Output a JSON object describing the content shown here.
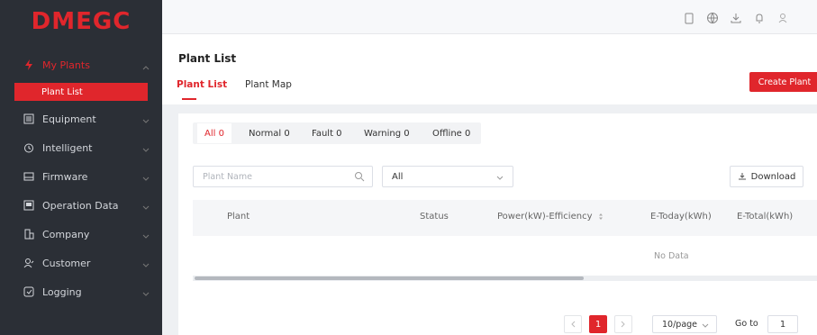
{
  "brand": {
    "logo_text": "DMEGC",
    "accent": "#e0262c"
  },
  "sidebar": {
    "items": [
      {
        "label": "My Plants",
        "icon": "lightning-icon",
        "active": true
      },
      {
        "label": "Plant List",
        "sub": true
      },
      {
        "label": "Equipment",
        "icon": "list-icon"
      },
      {
        "label": "Intelligent",
        "icon": "clock-icon"
      },
      {
        "label": "Firmware",
        "icon": "firmware-icon"
      },
      {
        "label": "Operation Data",
        "icon": "document-icon"
      },
      {
        "label": "Company",
        "icon": "building-icon"
      },
      {
        "label": "Customer",
        "icon": "user-icon"
      },
      {
        "label": "Logging",
        "icon": "log-icon"
      }
    ]
  },
  "header": {
    "icons": [
      "clipboard-icon",
      "globe-icon",
      "download-icon",
      "bell-icon",
      "user-icon"
    ]
  },
  "page": {
    "title": "Plant List",
    "tabs": [
      "Plant List",
      "Plant Map"
    ],
    "create_button": "Create Plant"
  },
  "filters": {
    "tabs": [
      "All 0",
      "Normal 0",
      "Fault 0",
      "Warning 0",
      "Offline 0"
    ],
    "search_placeholder": "Plant Name",
    "select_value": "All",
    "download_label": "Download"
  },
  "table": {
    "columns": [
      "Plant",
      "Status",
      "Power(kW)-Efficiency",
      "E-Today(kWh)",
      "E-Total(kWh)"
    ],
    "empty_text": "No Data"
  },
  "pagination": {
    "current_page": "1",
    "page_size": "10/page",
    "goto_label": "Go to",
    "goto_value": "1"
  }
}
